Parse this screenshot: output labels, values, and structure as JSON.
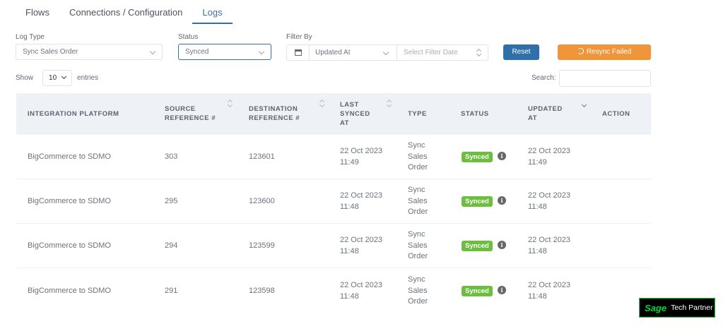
{
  "tabs": [
    {
      "label": "Flows",
      "active": false
    },
    {
      "label": "Connections / Configuration",
      "active": false
    },
    {
      "label": "Logs",
      "active": true
    }
  ],
  "filters": {
    "log_type_label": "Log Type",
    "log_type_value": "Sync Sales Order",
    "status_label": "Status",
    "status_value": "Synced",
    "filter_by_label": "Filter By",
    "filter_by_value": "Updated At",
    "filter_date_placeholder": "Select Filter Date",
    "reset_label": "Reset",
    "resync_label": "Resync Failed"
  },
  "table_controls": {
    "show_label": "Show",
    "page_length": "10",
    "entries_label": "entries",
    "search_label": "Search:",
    "search_value": ""
  },
  "table": {
    "columns": [
      "INTEGRATION PLATFORM",
      "SOURCE REFERENCE #",
      "DESTINATION REFERENCE #",
      "LAST SYNCED AT",
      "TYPE",
      "STATUS",
      "UPDATED AT",
      "ACTION"
    ],
    "rows": [
      {
        "platform": "BigCommerce to SDMO",
        "source": "303",
        "destination": "123601",
        "last_synced": "22 Oct 2023 11:49",
        "type": "Sync Sales Order",
        "status": "Synced",
        "updated": "22 Oct 2023 11:49",
        "action": ""
      },
      {
        "platform": "BigCommerce to SDMO",
        "source": "295",
        "destination": "123600",
        "last_synced": "22 Oct 2023 11:48",
        "type": "Sync Sales Order",
        "status": "Synced",
        "updated": "22 Oct 2023 11:48",
        "action": ""
      },
      {
        "platform": "BigCommerce to SDMO",
        "source": "294",
        "destination": "123599",
        "last_synced": "22 Oct 2023 11:48",
        "type": "Sync Sales Order",
        "status": "Synced",
        "updated": "22 Oct 2023 11:48",
        "action": ""
      },
      {
        "platform": "BigCommerce to SDMO",
        "source": "291",
        "destination": "123598",
        "last_synced": "22 Oct 2023 11:48",
        "type": "Sync Sales Order",
        "status": "Synced",
        "updated": "22 Oct 2023 11:48",
        "action": ""
      }
    ]
  },
  "branding": {
    "logo_text": "Sage Tech Partner"
  },
  "colors": {
    "primary": "#2f6fab",
    "resync": "#f0953a",
    "synced_badge": "#6cbf3c",
    "table_header_bg": "#eef1f5"
  }
}
